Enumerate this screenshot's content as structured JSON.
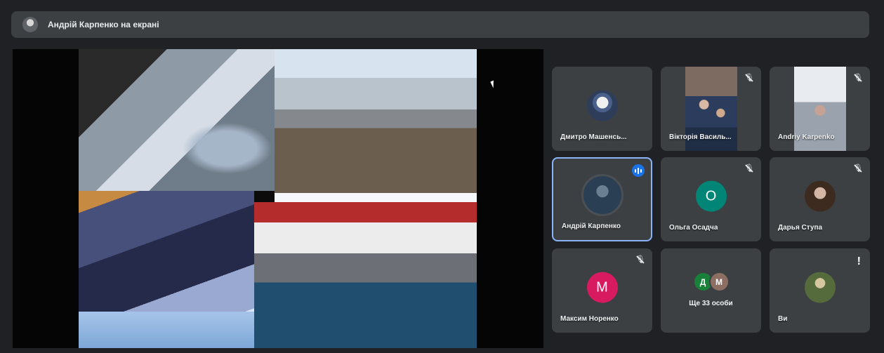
{
  "presenter": {
    "label": "Андрій Карпенко на екрані"
  },
  "participants": [
    {
      "name": "Дмитро Машенсь..."
    },
    {
      "name": "Вікторія Василь..."
    },
    {
      "name": "Andriy Karpenko"
    },
    {
      "name": "Андрій Карпенко"
    },
    {
      "name": "Ольга Осадча",
      "initial": "О"
    },
    {
      "name": "Дарья Ступа"
    },
    {
      "name": "Максим Норенко",
      "initial": "М"
    },
    {
      "name": "Ще 33 особи",
      "initials": [
        "Д",
        "М"
      ]
    },
    {
      "name": "Ви"
    }
  ],
  "colors": {
    "background": "#202124",
    "tile": "#3c4043",
    "active_border": "#8ab4f8",
    "speaking": "#1a73e8",
    "teal": "#008577",
    "magenta": "#d81b60"
  }
}
